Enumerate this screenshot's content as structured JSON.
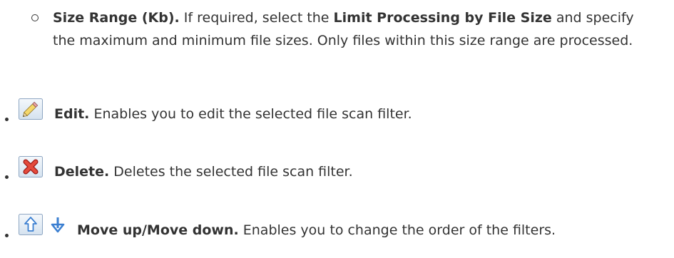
{
  "size_range": {
    "bullet_icon": "hollow-circle-bullet",
    "title": "Size Range (Kb).",
    "text_a": " If required, select the ",
    "bold_b": "Limit Processing by File Size",
    "text_c": " and specify the maximum and minimum file sizes. Only files within this size range are processed."
  },
  "items": [
    {
      "icon": "pencil-edit-icon",
      "title": "Edit.",
      "text": " Enables you to edit the selected file scan filter."
    },
    {
      "icon": "red-x-delete-icon",
      "title": "Delete.",
      "text": " Deletes the selected file scan filter."
    },
    {
      "icons": [
        "arrow-up-icon",
        "arrow-down-icon"
      ],
      "title": "Move up/Move down.",
      "text": " Enables you to change the order of the filters."
    }
  ],
  "colors": {
    "text": "#333333",
    "icon_border": "#7f9db9",
    "delete_red": "#d8322c",
    "arrow_blue": "#3b7fd1"
  }
}
